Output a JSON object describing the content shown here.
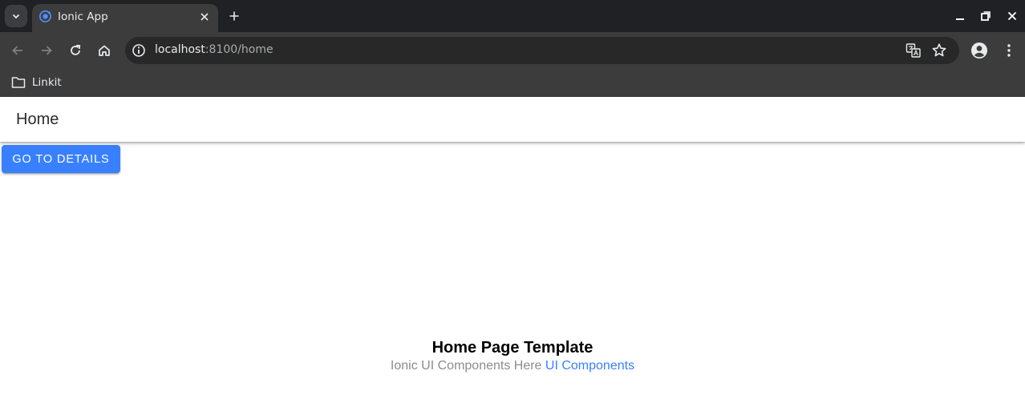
{
  "browser": {
    "tab": {
      "title": "Ionic App",
      "favicon": "ionic-favicon-icon"
    },
    "address": {
      "host": "localhost",
      "path": ":8100/home"
    },
    "bookmarks": [
      {
        "label": "Linkit",
        "icon": "folder-icon"
      }
    ],
    "colors": {
      "tabstrip": "#202124",
      "toolbar": "#3c3c3c",
      "omnibox": "#282828"
    }
  },
  "app": {
    "header_title": "Home",
    "button_label": "GO TO DETAILS",
    "template_title": "Home Page Template",
    "template_text": "Ionic UI Components Here",
    "template_link": "UI Components",
    "colors": {
      "primary": "#3880ff"
    }
  }
}
